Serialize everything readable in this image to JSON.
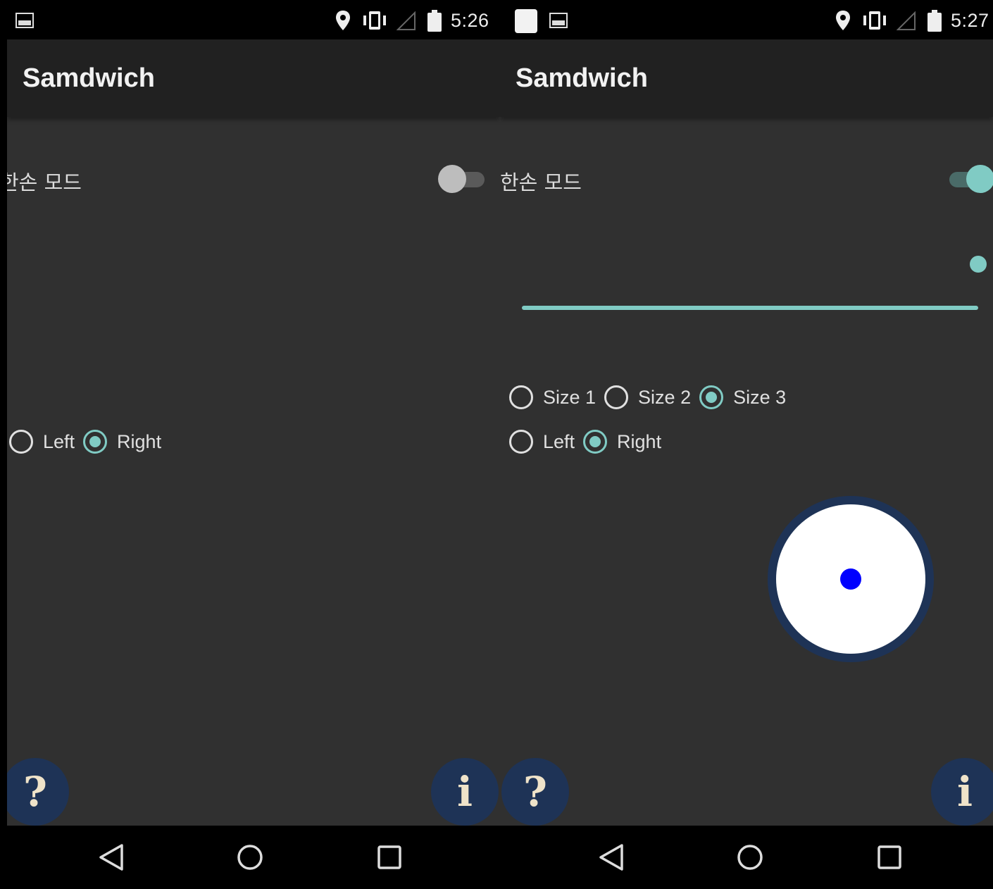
{
  "colors": {
    "accent": "#80cbc4",
    "fab": "#1e3356",
    "background": "#303030",
    "appbar": "#212121",
    "joystick_dot": "#0000ff"
  },
  "left": {
    "status": {
      "time": "5:26"
    },
    "toolbar": {
      "title": "Samdwich"
    },
    "one_hand_mode": {
      "label": "한손 모드",
      "enabled": false
    },
    "hand": {
      "options": [
        "Left",
        "Right"
      ],
      "selected": "Right"
    },
    "fab_help": {
      "glyph": "?",
      "icon": "help-icon"
    },
    "fab_info": {
      "glyph": "i",
      "icon": "info-icon"
    }
  },
  "right": {
    "status": {
      "time": "5:27"
    },
    "toolbar": {
      "title": "Samdwich"
    },
    "one_hand_mode": {
      "label": "한손 모드",
      "enabled": true
    },
    "size": {
      "options": [
        "Size 1",
        "Size 2",
        "Size 3"
      ],
      "selected": "Size 3"
    },
    "hand": {
      "options": [
        "Left",
        "Right"
      ],
      "selected": "Right"
    },
    "fab_help": {
      "glyph": "?",
      "icon": "help-icon"
    },
    "fab_info": {
      "glyph": "i",
      "icon": "info-icon"
    }
  },
  "navbar": {
    "buttons": [
      "back-icon",
      "home-icon",
      "recents-icon"
    ]
  }
}
